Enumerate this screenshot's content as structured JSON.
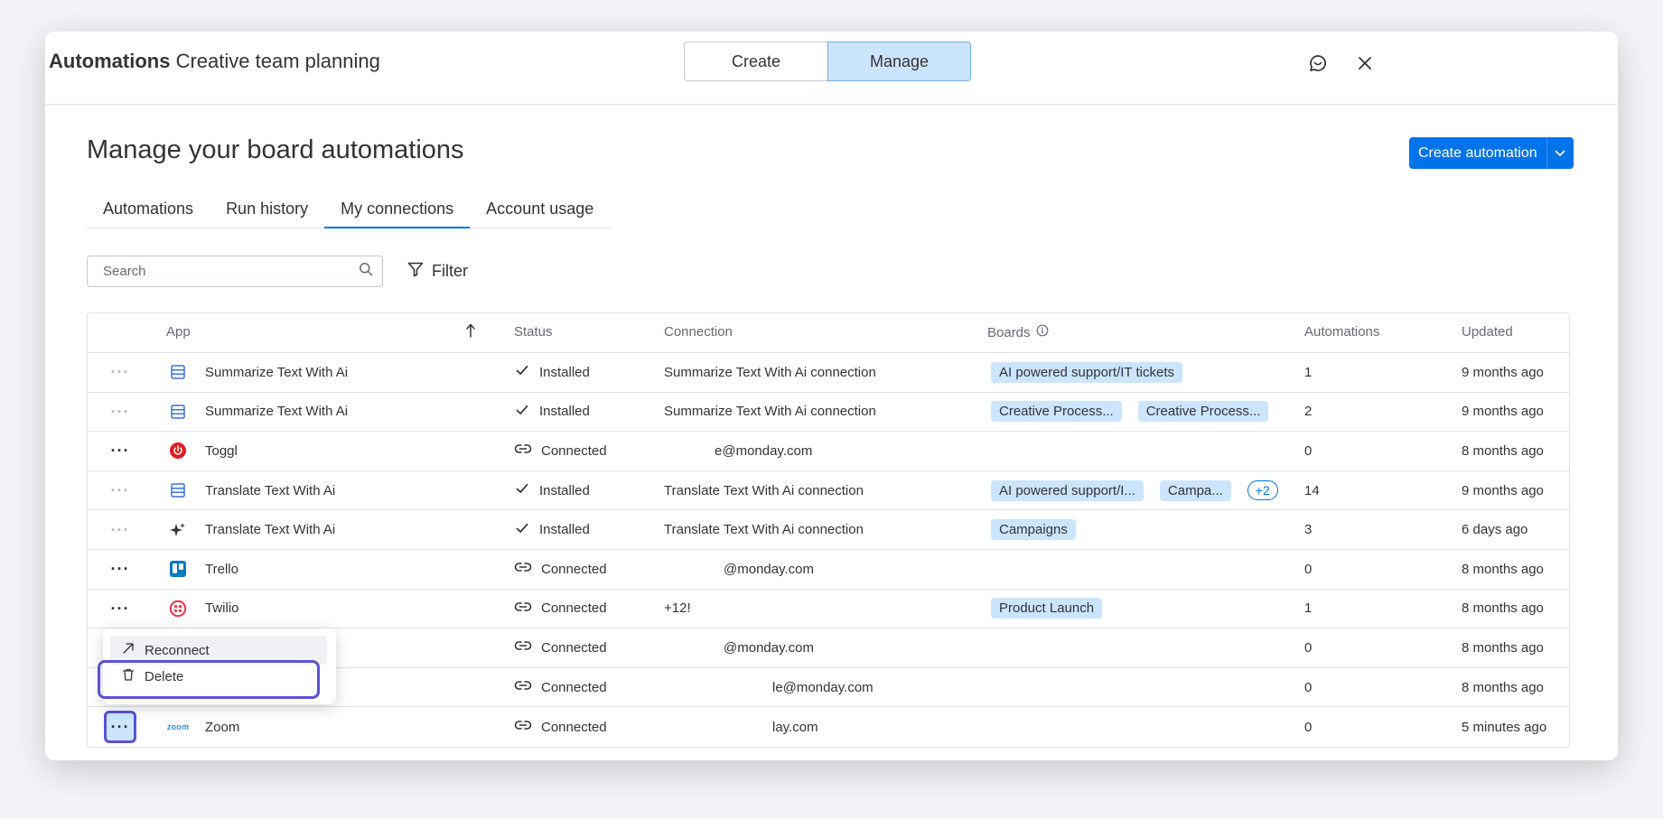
{
  "header": {
    "title_bold": "Automations",
    "title_rest": "Creative team planning",
    "segments": [
      "Create",
      "Manage"
    ],
    "active_segment": "Manage"
  },
  "main": {
    "heading": "Manage your board automations",
    "create_button": "Create automation",
    "tabs": [
      "Automations",
      "Run history",
      "My connections",
      "Account usage"
    ],
    "active_tab": "My connections",
    "search_placeholder": "Search",
    "filter_label": "Filter"
  },
  "table": {
    "columns": {
      "app": "App",
      "status": "Status",
      "connection": "Connection",
      "boards": "Boards",
      "automations": "Automations",
      "updated": "Updated"
    },
    "rows": [
      {
        "icon": "summarize-ai-icon",
        "app": "Summarize Text With Ai",
        "status": "Installed",
        "connection": "Summarize Text With Ai connection",
        "boards": [
          "AI powered support/IT tickets"
        ],
        "more": "",
        "automations": "1",
        "updated": "9 months ago"
      },
      {
        "icon": "summarize-ai-icon",
        "app": "Summarize Text With Ai",
        "status": "Installed",
        "connection": "Summarize Text With Ai connection",
        "boards": [
          "Creative Process...",
          "Creative Process..."
        ],
        "more": "",
        "automations": "2",
        "updated": "9 months ago"
      },
      {
        "icon": "toggl-icon",
        "app": "Toggl",
        "status": "Connected",
        "connection": "e@monday.com",
        "boards": [],
        "more": "",
        "automations": "0",
        "updated": "8 months ago"
      },
      {
        "icon": "translate-ai-icon",
        "app": "Translate Text With Ai",
        "status": "Installed",
        "connection": "Translate Text With Ai connection",
        "boards": [
          "AI powered support/I...",
          "Campa..."
        ],
        "more": "+2",
        "automations": "14",
        "updated": "9 months ago"
      },
      {
        "icon": "sparkle-icon",
        "app": "Translate Text With Ai",
        "status": "Installed",
        "connection": "Translate Text With Ai connection",
        "boards": [
          "Campaigns"
        ],
        "more": "",
        "automations": "3",
        "updated": "6 days ago"
      },
      {
        "icon": "trello-icon",
        "app": "Trello",
        "status": "Connected",
        "connection": "@monday.com",
        "boards": [],
        "more": "",
        "automations": "0",
        "updated": "8 months ago"
      },
      {
        "icon": "twilio-icon",
        "app": "Twilio",
        "status": "Connected",
        "connection": "+12!",
        "boards": [
          "Product Launch"
        ],
        "more": "",
        "automations": "1",
        "updated": "8 months ago"
      },
      {
        "icon": "",
        "app": "",
        "status": "Connected",
        "connection": "@monday.com",
        "boards": [],
        "more": "",
        "automations": "0",
        "updated": "8 months ago"
      },
      {
        "icon": "",
        "app": "",
        "status": "Connected",
        "connection": "le@monday.com",
        "boards": [],
        "more": "",
        "automations": "0",
        "updated": "8 months ago"
      },
      {
        "icon": "zoom-icon",
        "app": "Zoom",
        "status": "Connected",
        "connection": "lay.com",
        "boards": [],
        "more": "",
        "automations": "0",
        "updated": "5 minutes ago"
      }
    ]
  },
  "context_menu": {
    "reconnect": "Reconnect",
    "delete": "Delete"
  },
  "icons": {
    "zoom_logo_text": "zoom"
  },
  "colors": {
    "accent": "#0073ea",
    "selected_bg": "#cce5ff",
    "highlight": "#5a52d5",
    "toggl": "#e01b22",
    "twilio": "#f22f46",
    "trello": "#0079bf"
  }
}
